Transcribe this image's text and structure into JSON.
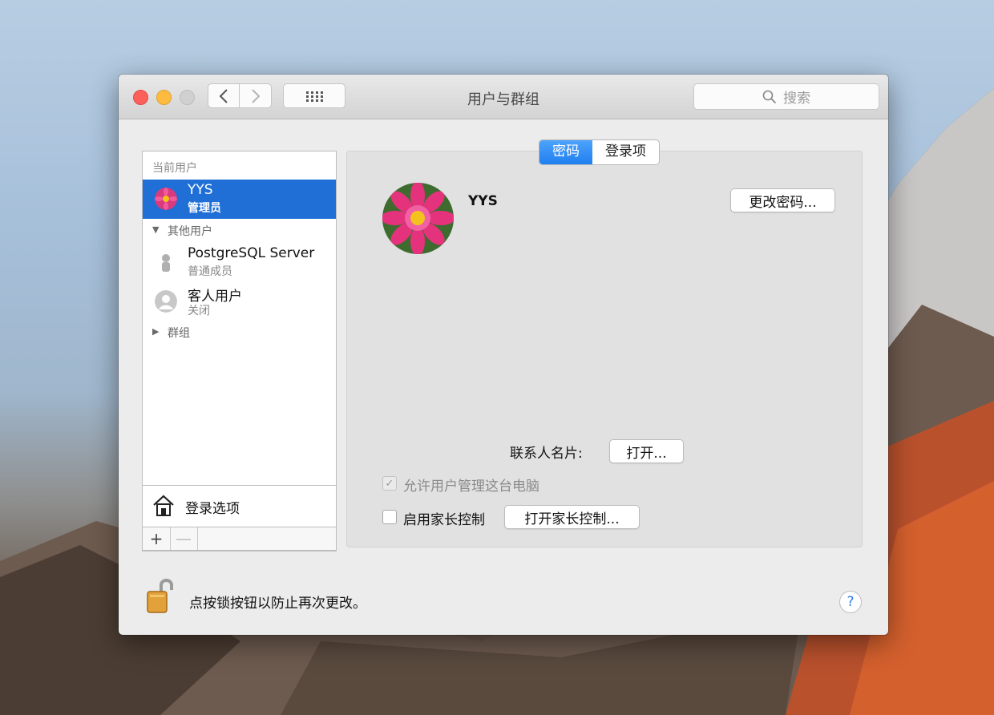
{
  "window": {
    "title": "用户与群组"
  },
  "toolbar": {
    "search_placeholder": "搜索"
  },
  "sidebar": {
    "current_users_label": "当前用户",
    "current_user": {
      "name": "YYS",
      "role": "管理员"
    },
    "other_users_label": "其他用户",
    "other_users": [
      {
        "name": "PostgreSQL Server",
        "role": "普通成员"
      },
      {
        "name": "客人用户",
        "role": "关闭"
      }
    ],
    "groups_label": "群组",
    "login_options": "登录选项",
    "add_label": "+",
    "remove_label": "—"
  },
  "tabs": [
    {
      "label": "密码",
      "selected": true
    },
    {
      "label": "登录项",
      "selected": false
    }
  ],
  "main": {
    "user_name": "YYS",
    "change_password_button": "更改密码...",
    "contact_card_label": "联系人名片:",
    "open_button": "打开...",
    "allow_admin_label": "允许用户管理这台电脑",
    "allow_admin_checked": true,
    "parental_controls_label": "启用家长控制",
    "parental_controls_checked": false,
    "open_parental_button": "打开家长控制..."
  },
  "footer": {
    "lock_text": "点按锁按钮以防止再次更改。",
    "help_label": "?"
  },
  "colors": {
    "selection": "#1f6fd6",
    "segment_active": "#2a86f3",
    "close": "#fc605b",
    "minimize": "#fdbc40"
  }
}
